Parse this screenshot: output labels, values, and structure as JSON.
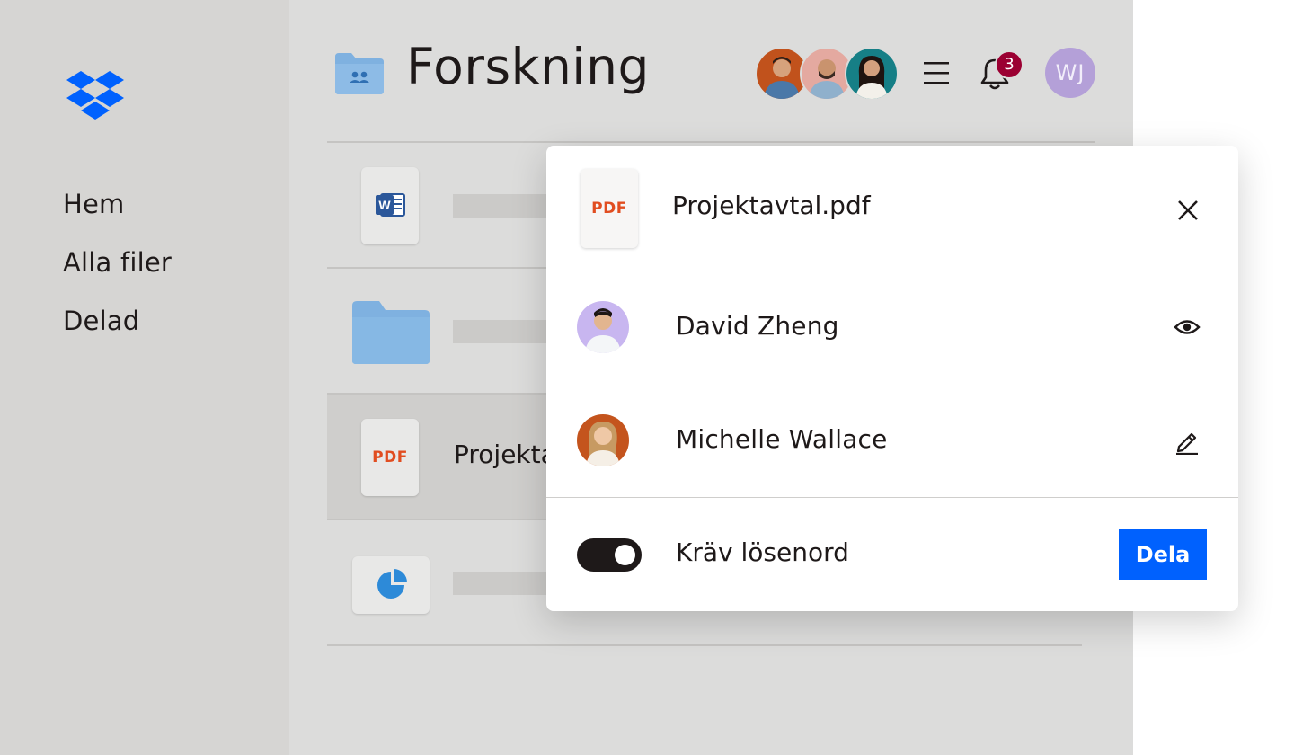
{
  "sidebar": {
    "items": [
      {
        "label": "Hem"
      },
      {
        "label": "Alla filer"
      },
      {
        "label": "Delad"
      }
    ]
  },
  "header": {
    "title": "Forskning",
    "notification_count": "3",
    "user_initials": "WJ"
  },
  "file_list": {
    "rows": [
      {
        "icon": "word-doc-icon",
        "label": ""
      },
      {
        "icon": "folder-icon",
        "label": ""
      },
      {
        "icon": "pdf-icon",
        "label": "Projekta",
        "file_type_text": "PDF"
      },
      {
        "icon": "pie-chart-icon",
        "label": ""
      }
    ]
  },
  "share_modal": {
    "file_name": "Projektavtal.pdf",
    "file_type_text": "PDF",
    "people": [
      {
        "name": "David Zheng",
        "permission_icon": "eye-icon"
      },
      {
        "name": "Michelle Wallace",
        "permission_icon": "pencil-icon"
      }
    ],
    "password_toggle_label": "Kräv lösenord",
    "password_toggle_on": true,
    "share_button_label": "Dela"
  },
  "colors": {
    "brand_blue": "#0061fe",
    "sidebar_bg": "#d6d5d3",
    "main_bg": "#dcdcdb",
    "badge": "#9b0032",
    "pdf_red": "#e14d20",
    "folder_blue": "#7fb1e0",
    "user_avatar": "#b4a0d8"
  }
}
